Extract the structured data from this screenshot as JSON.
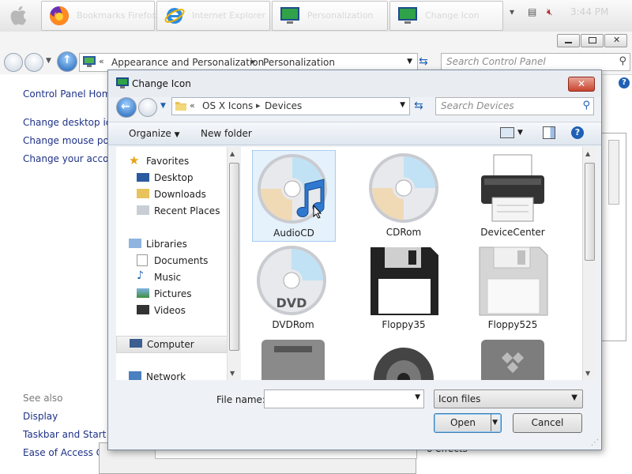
{
  "taskbar": {
    "tasks": [
      {
        "label": "Bookmarks Firefox",
        "icon": "firefox-icon"
      },
      {
        "label": "Internet Explorer",
        "icon": "ie-icon"
      },
      {
        "label": "Personalization",
        "icon": "monitor-icon"
      },
      {
        "label": "Change Icon",
        "icon": "monitor-icon"
      }
    ],
    "clock": "3:44 PM"
  },
  "control_panel": {
    "address": {
      "prefix": "«",
      "crumb1": "Appearance and Personalization",
      "sep": "▸",
      "crumb2": "Personalization"
    },
    "search_placeholder": "Search Control Panel",
    "left_links": [
      "Control Panel Home",
      "Change desktop ic",
      "Change mouse po",
      "Change your acco"
    ],
    "see_also": "See also",
    "see_also_links": [
      "Display",
      "Taskbar and Start M",
      "Ease of Access Cen"
    ],
    "behind_text": "o effects"
  },
  "dialog": {
    "title": "Change Icon",
    "address": {
      "prefix": "«",
      "crumb1": "OS X Icons",
      "sep": "▸",
      "crumb2": "Devices"
    },
    "search_placeholder": "Search Devices",
    "toolbar": {
      "organize": "Organize",
      "new_folder": "New folder"
    },
    "tree": {
      "favorites": "Favorites",
      "favorites_items": [
        "Desktop",
        "Downloads",
        "Recent Places"
      ],
      "libraries": "Libraries",
      "libraries_items": [
        "Documents",
        "Music",
        "Pictures",
        "Videos"
      ],
      "computer": "Computer",
      "network": "Network"
    },
    "icons": [
      "AudioCD",
      "CDRom",
      "DeviceCenter",
      "DVDRom",
      "Floppy35",
      "Floppy525",
      "",
      "",
      ""
    ],
    "selected_icon": "AudioCD",
    "file_name_label": "File name:",
    "file_name_value": "",
    "file_type": "Icon files",
    "open_label": "Open",
    "cancel_label": "Cancel"
  },
  "colors": {
    "link": "#1e3287",
    "selection": "#e5f1fb",
    "close_red": "#c9442f"
  }
}
